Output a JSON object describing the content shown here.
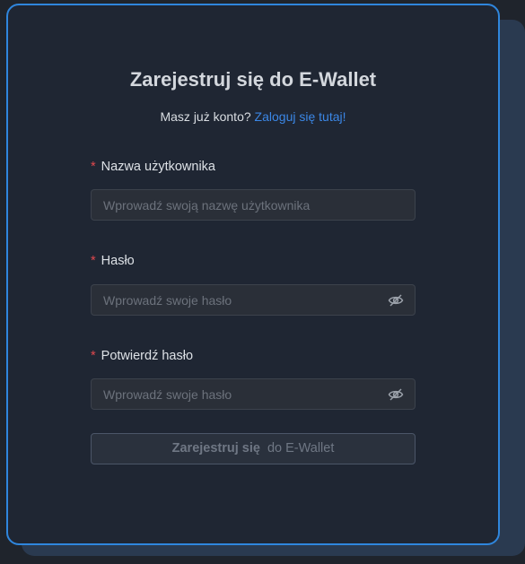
{
  "header": {
    "title_bold": "Zarejestruj się",
    "title_rest": "do E-Wallet"
  },
  "subtitle": {
    "text": "Masz już konto?",
    "link": "Zaloguj się tutaj!"
  },
  "form": {
    "required_mark": "*",
    "username": {
      "label": "Nazwa użytkownika",
      "placeholder": "Wprowadź swoją nazwę użytkownika",
      "value": ""
    },
    "password": {
      "label": "Hasło",
      "placeholder": "Wprowadź swoje hasło",
      "value": "",
      "toggle_icon": "eye-off-icon"
    },
    "confirm_password": {
      "label": "Potwierdź hasło",
      "placeholder": "Wprowadź swoje hasło",
      "value": "",
      "toggle_icon": "eye-off-icon"
    },
    "submit": {
      "label_bold": "Zarejestruj się",
      "label_rest": "do E-Wallet",
      "disabled": true
    }
  },
  "colors": {
    "accent": "#2f86dd",
    "link": "#3b87e6",
    "required": "#e0484e",
    "card_bg": "#1f2633"
  }
}
